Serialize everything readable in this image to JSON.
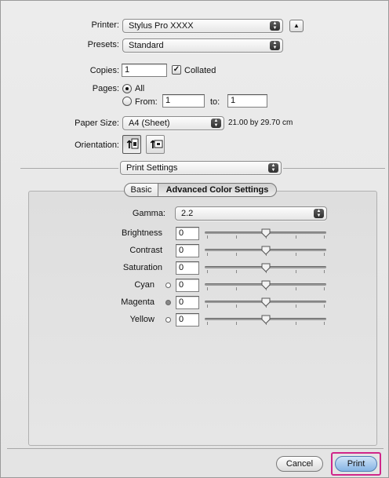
{
  "printer": {
    "label": "Printer:",
    "value": "Stylus Pro XXXX"
  },
  "presets": {
    "label": "Presets:",
    "value": "Standard"
  },
  "copies": {
    "label": "Copies:",
    "value": "1",
    "collated_label": "Collated",
    "collated": true
  },
  "pages": {
    "label": "Pages:",
    "all_label": "All",
    "from_label": "From:",
    "from_value": "1",
    "to_label": "to:",
    "to_value": "1",
    "selected": "all"
  },
  "paper_size": {
    "label": "Paper Size:",
    "value": "A4 (Sheet)",
    "dimensions": "21.00 by 29.70 cm"
  },
  "orientation": {
    "label": "Orientation:"
  },
  "section_popup": {
    "value": "Print Settings"
  },
  "tabs": {
    "basic": "Basic",
    "advanced": "Advanced Color Settings",
    "selected": "advanced"
  },
  "gamma": {
    "label": "Gamma:",
    "value": "2.2"
  },
  "adjustments": [
    {
      "label": "Brightness",
      "value": "0",
      "ink": null
    },
    {
      "label": "Contrast",
      "value": "0",
      "ink": null
    },
    {
      "label": "Saturation",
      "value": "0",
      "ink": null
    },
    {
      "label": "Cyan",
      "value": "0",
      "ink": "#ffffff"
    },
    {
      "label": "Magenta",
      "value": "0",
      "ink": "#888888"
    },
    {
      "label": "Yellow",
      "value": "0",
      "ink": "#ffffff"
    }
  ],
  "buttons": {
    "cancel": "Cancel",
    "print": "Print"
  },
  "colors": {
    "highlight": "#d0268a"
  }
}
